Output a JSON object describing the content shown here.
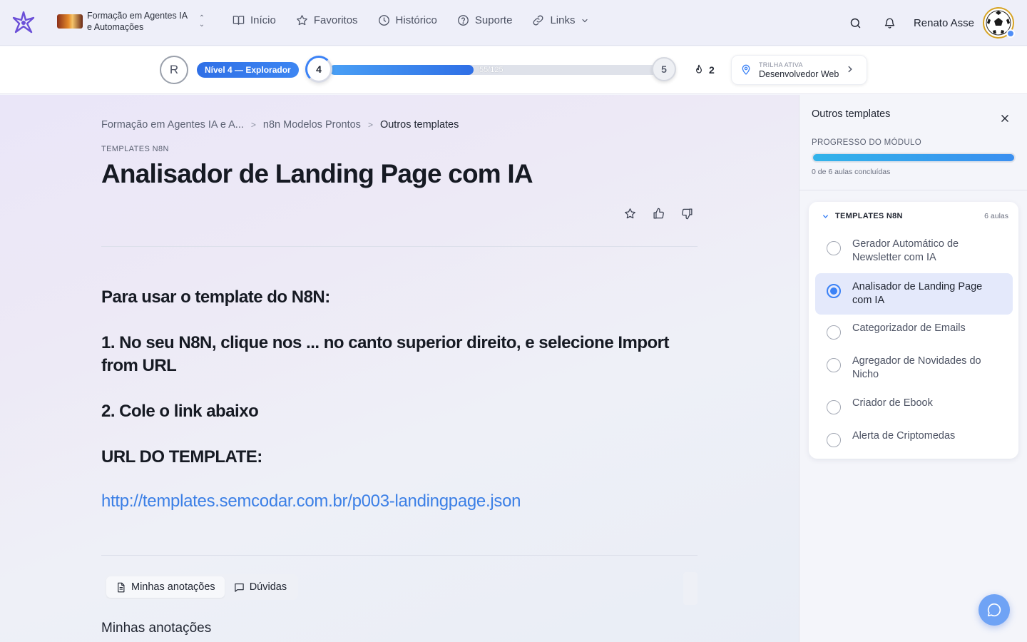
{
  "header": {
    "course_title": "Formação em Agentes IA e Automações",
    "nav": [
      {
        "label": "Início",
        "icon": "book-open-icon"
      },
      {
        "label": "Favoritos",
        "icon": "star-icon"
      },
      {
        "label": "Histórico",
        "icon": "clock-icon"
      },
      {
        "label": "Suporte",
        "icon": "help-circle-icon"
      },
      {
        "label": "Links",
        "icon": "link-icon"
      }
    ],
    "user_name": "Renato Asse"
  },
  "level": {
    "avatar_initial": "R",
    "badge": "Nível 4 — Explorador",
    "current_level": "4",
    "next_level": "5",
    "xp_text": "55/125",
    "xp_fraction": 0.44,
    "streak": "2",
    "track_label": "TRILHA ATIVA",
    "track_name": "Desenvolvedor Web"
  },
  "breadcrumb": {
    "item1": "Formação em Agentes IA e A...",
    "item2": "n8n Modelos Prontos",
    "item3": "Outros templates"
  },
  "lesson": {
    "kicker": "TEMPLATES N8N",
    "title": "Analisador de Landing Page com IA",
    "content": {
      "line1": "Para usar o template do N8N:",
      "line2": "1. No seu N8N, clique nos ... no canto superior direito, e selecione Import from URL",
      "line3": "2. Cole o link abaixo",
      "line4": "URL DO TEMPLATE:",
      "link": "http://templates.semcodar.com.br/p003-landingpage.json"
    },
    "tabs": {
      "notes": "Minhas anotações",
      "questions": "Dúvidas"
    },
    "notes_title": "Minhas anotações"
  },
  "sidebar": {
    "title": "Outros templates",
    "progress_label": "PROGRESSO DO MÓDULO",
    "progress_text": "0 de 6 aulas concluídas",
    "section_title": "TEMPLATES N8N",
    "section_count": "6 aulas",
    "lessons": [
      {
        "name": "Gerador Automático de Newsletter com IA"
      },
      {
        "name": "Analisador de Landing Page com IA"
      },
      {
        "name": "Categorizador de Emails"
      },
      {
        "name": "Agregador de Novidades do Nicho"
      },
      {
        "name": "Criador de Ebook"
      },
      {
        "name": "Alerta de Criptomedas"
      }
    ]
  },
  "colors": {
    "accent": "#3b82f6",
    "link": "#3b7fe6",
    "badge": "#2f6fe6"
  }
}
